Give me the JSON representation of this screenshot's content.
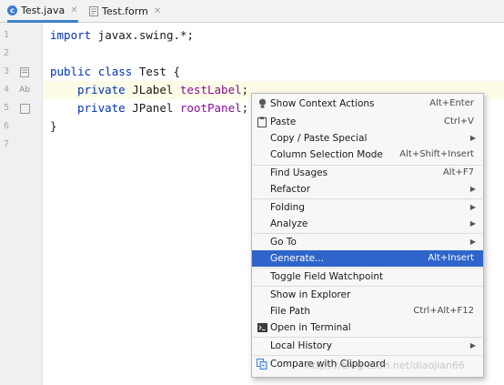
{
  "tabs": [
    {
      "label": "Test.java",
      "icon": "class-icon",
      "active": true
    },
    {
      "label": "Test.form",
      "icon": "form-icon",
      "active": false
    }
  ],
  "gutter": {
    "line_numbers": [
      "1",
      "2",
      "3",
      "4",
      "5",
      "6",
      "7"
    ]
  },
  "code": {
    "line1": {
      "kw": "import",
      "rest": " javax.swing.*;"
    },
    "line3": {
      "kw1": "public",
      "kw2": "class",
      "rest": " Test {"
    },
    "line4": {
      "kw": "private",
      "type": " JLabel ",
      "field": "testLabel",
      "end": ";"
    },
    "line5": {
      "kw": "private",
      "type": " JPanel ",
      "field": "rootPanel",
      "end": ";"
    },
    "line6": "}"
  },
  "menu": {
    "show_context_actions": {
      "label": "Show Context Actions",
      "shortcut": "Alt+Enter"
    },
    "paste": {
      "label": "Paste",
      "shortcut": "Ctrl+V"
    },
    "copy_paste_special": {
      "label": "Copy / Paste Special"
    },
    "column_selection": {
      "label": "Column Selection Mode",
      "shortcut": "Alt+Shift+Insert"
    },
    "find_usages": {
      "label": "Find Usages",
      "shortcut": "Alt+F7"
    },
    "refactor": {
      "label": "Refactor"
    },
    "folding": {
      "label": "Folding"
    },
    "analyze": {
      "label": "Analyze"
    },
    "go_to": {
      "label": "Go To"
    },
    "generate": {
      "label": "Generate...",
      "shortcut": "Alt+Insert"
    },
    "toggle_field_watchpoint": {
      "label": "Toggle Field Watchpoint"
    },
    "show_in_explorer": {
      "label": "Show in Explorer"
    },
    "file_path": {
      "label": "File Path",
      "shortcut": "Ctrl+Alt+F12"
    },
    "open_in_terminal": {
      "label": "Open in Terminal"
    },
    "local_history": {
      "label": "Local History"
    },
    "compare_with_clipboard": {
      "label": "Compare with Clipboard"
    }
  },
  "watermark": "https://blog.csdn.net/diaojian66",
  "colors": {
    "accent": "#2f65ca",
    "keyword": "#0033b3",
    "field": "#871094"
  }
}
